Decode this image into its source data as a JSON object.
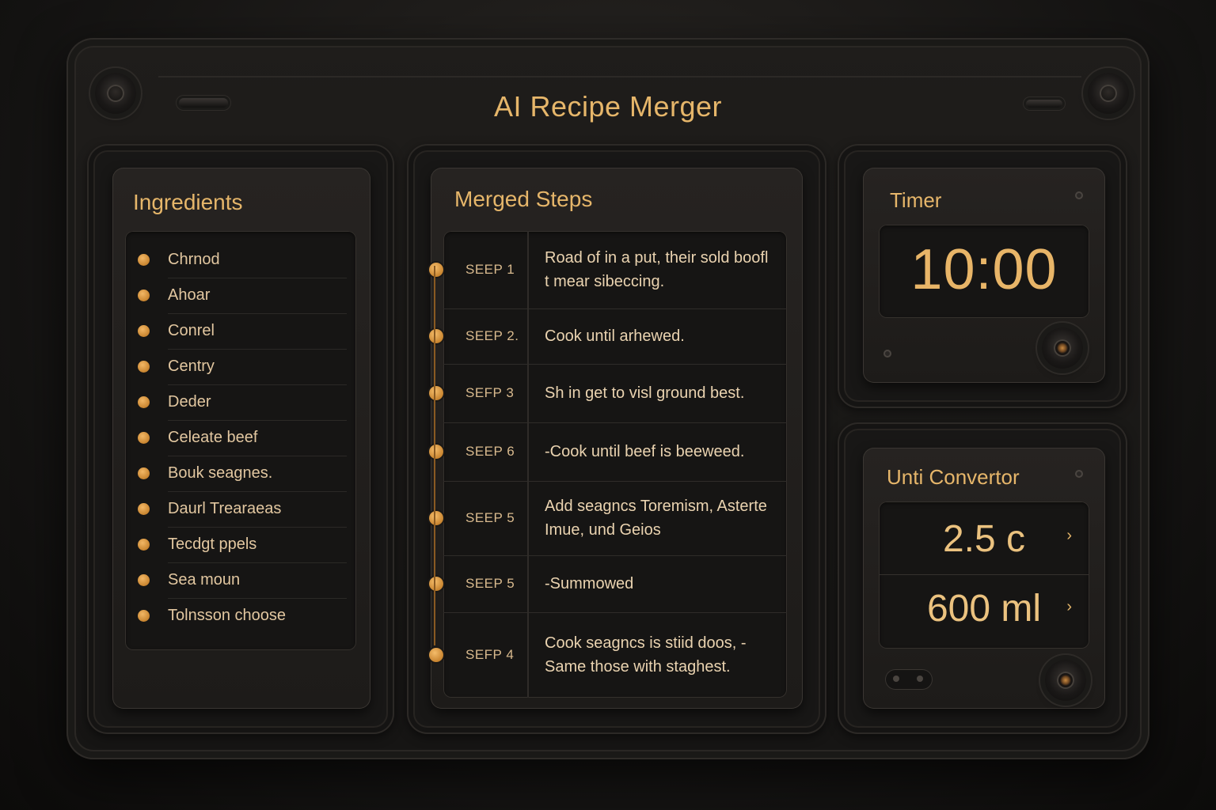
{
  "app": {
    "title": "AI Recipe Merger"
  },
  "ingredients": {
    "title": "Ingredients",
    "items": [
      "Chrnod",
      "Ahoar",
      "Conrel",
      "Centry",
      "Deder",
      "Celeate beef",
      "Bouk seagnes.",
      "Daurl Trearaeas",
      "Tecdgt ppels",
      "Sea moun",
      "Tolnsson choose"
    ]
  },
  "steps": {
    "title": "Merged Steps",
    "items": [
      {
        "label": "SEEP 1",
        "text": "Road of in a put, their sold boofl t mear sibeccing."
      },
      {
        "label": "SEEP 2.",
        "text": "Cook until arhewed."
      },
      {
        "label": "SEFP 3",
        "text": "Sh in get to visl ground best."
      },
      {
        "label": "SEEP 6",
        "text": "-Cook until beef is beeweed."
      },
      {
        "label": "SEEP 5",
        "text": "Add seagncs Toremism, Asterte Imue, und Geios"
      },
      {
        "label": "SEEP 5",
        "text": "-Summowed"
      },
      {
        "label": "SEFP 4",
        "text": "Cook seagncs is stiid doos, -Same those with staghest."
      }
    ]
  },
  "timer": {
    "title": "Timer",
    "value": "10:00"
  },
  "converter": {
    "title": "Unti Convertor",
    "from_value": "2.5 c",
    "to_value": "600 ml"
  },
  "colors": {
    "accent": "#e6b66a",
    "background": "#161514"
  },
  "icons": {
    "chevron": "chevron-right-icon",
    "knob": "knob-icon"
  }
}
